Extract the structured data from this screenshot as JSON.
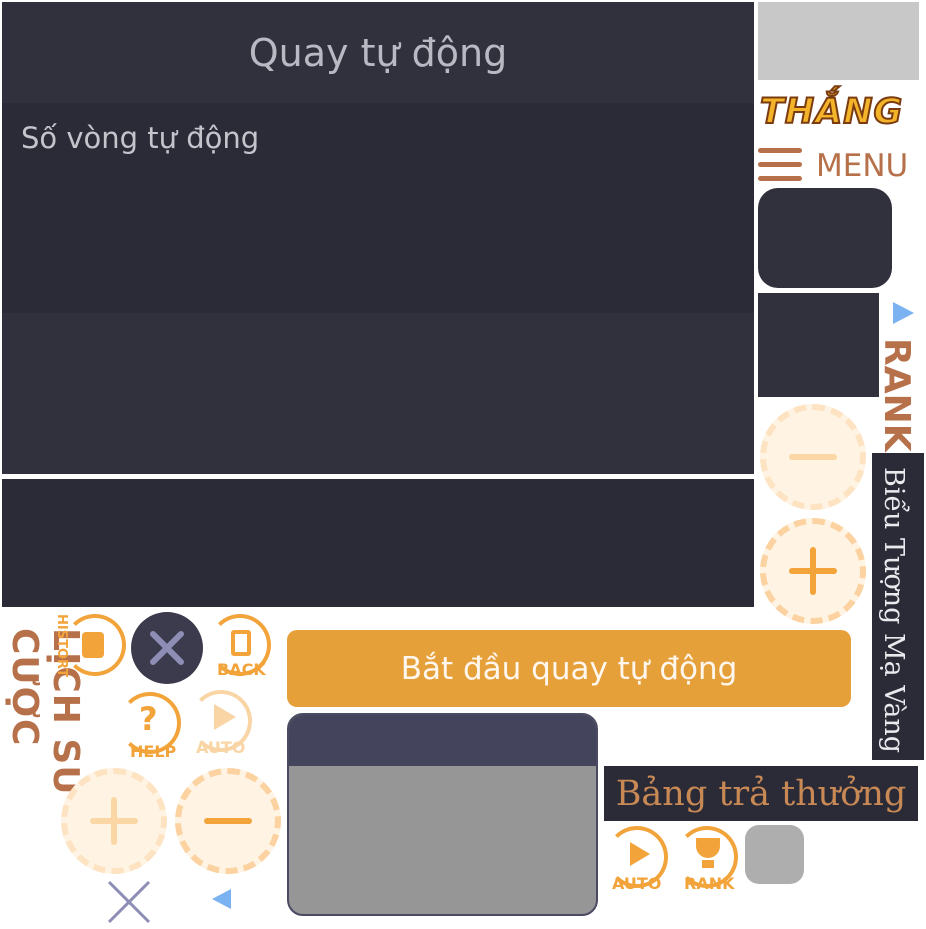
{
  "panel": {
    "title": "Quay tự động",
    "rounds_label": "Số vòng tự động"
  },
  "start_button_label": "Bắt đầu quay tự động",
  "logo_text": "THẮNG",
  "menu_label": "MENU",
  "rank_label": "RANK",
  "icon_title": "Biểu Tượng Mạ Vàng",
  "payout_table_label": "Bảng trả thưởng",
  "history_title": "LỊCH SỬ CƯỢC",
  "small_buttons": {
    "history": "HISTORT",
    "back": "BACK",
    "help": "HELP",
    "auto": "AUTO",
    "auto2": "AUTO",
    "rank2": "RANK"
  },
  "colors": {
    "panel_dark": "#2b2b37",
    "accent_orange": "#e6a03a",
    "brown_text": "#b7714a",
    "chip_light": "#fde3c2"
  }
}
